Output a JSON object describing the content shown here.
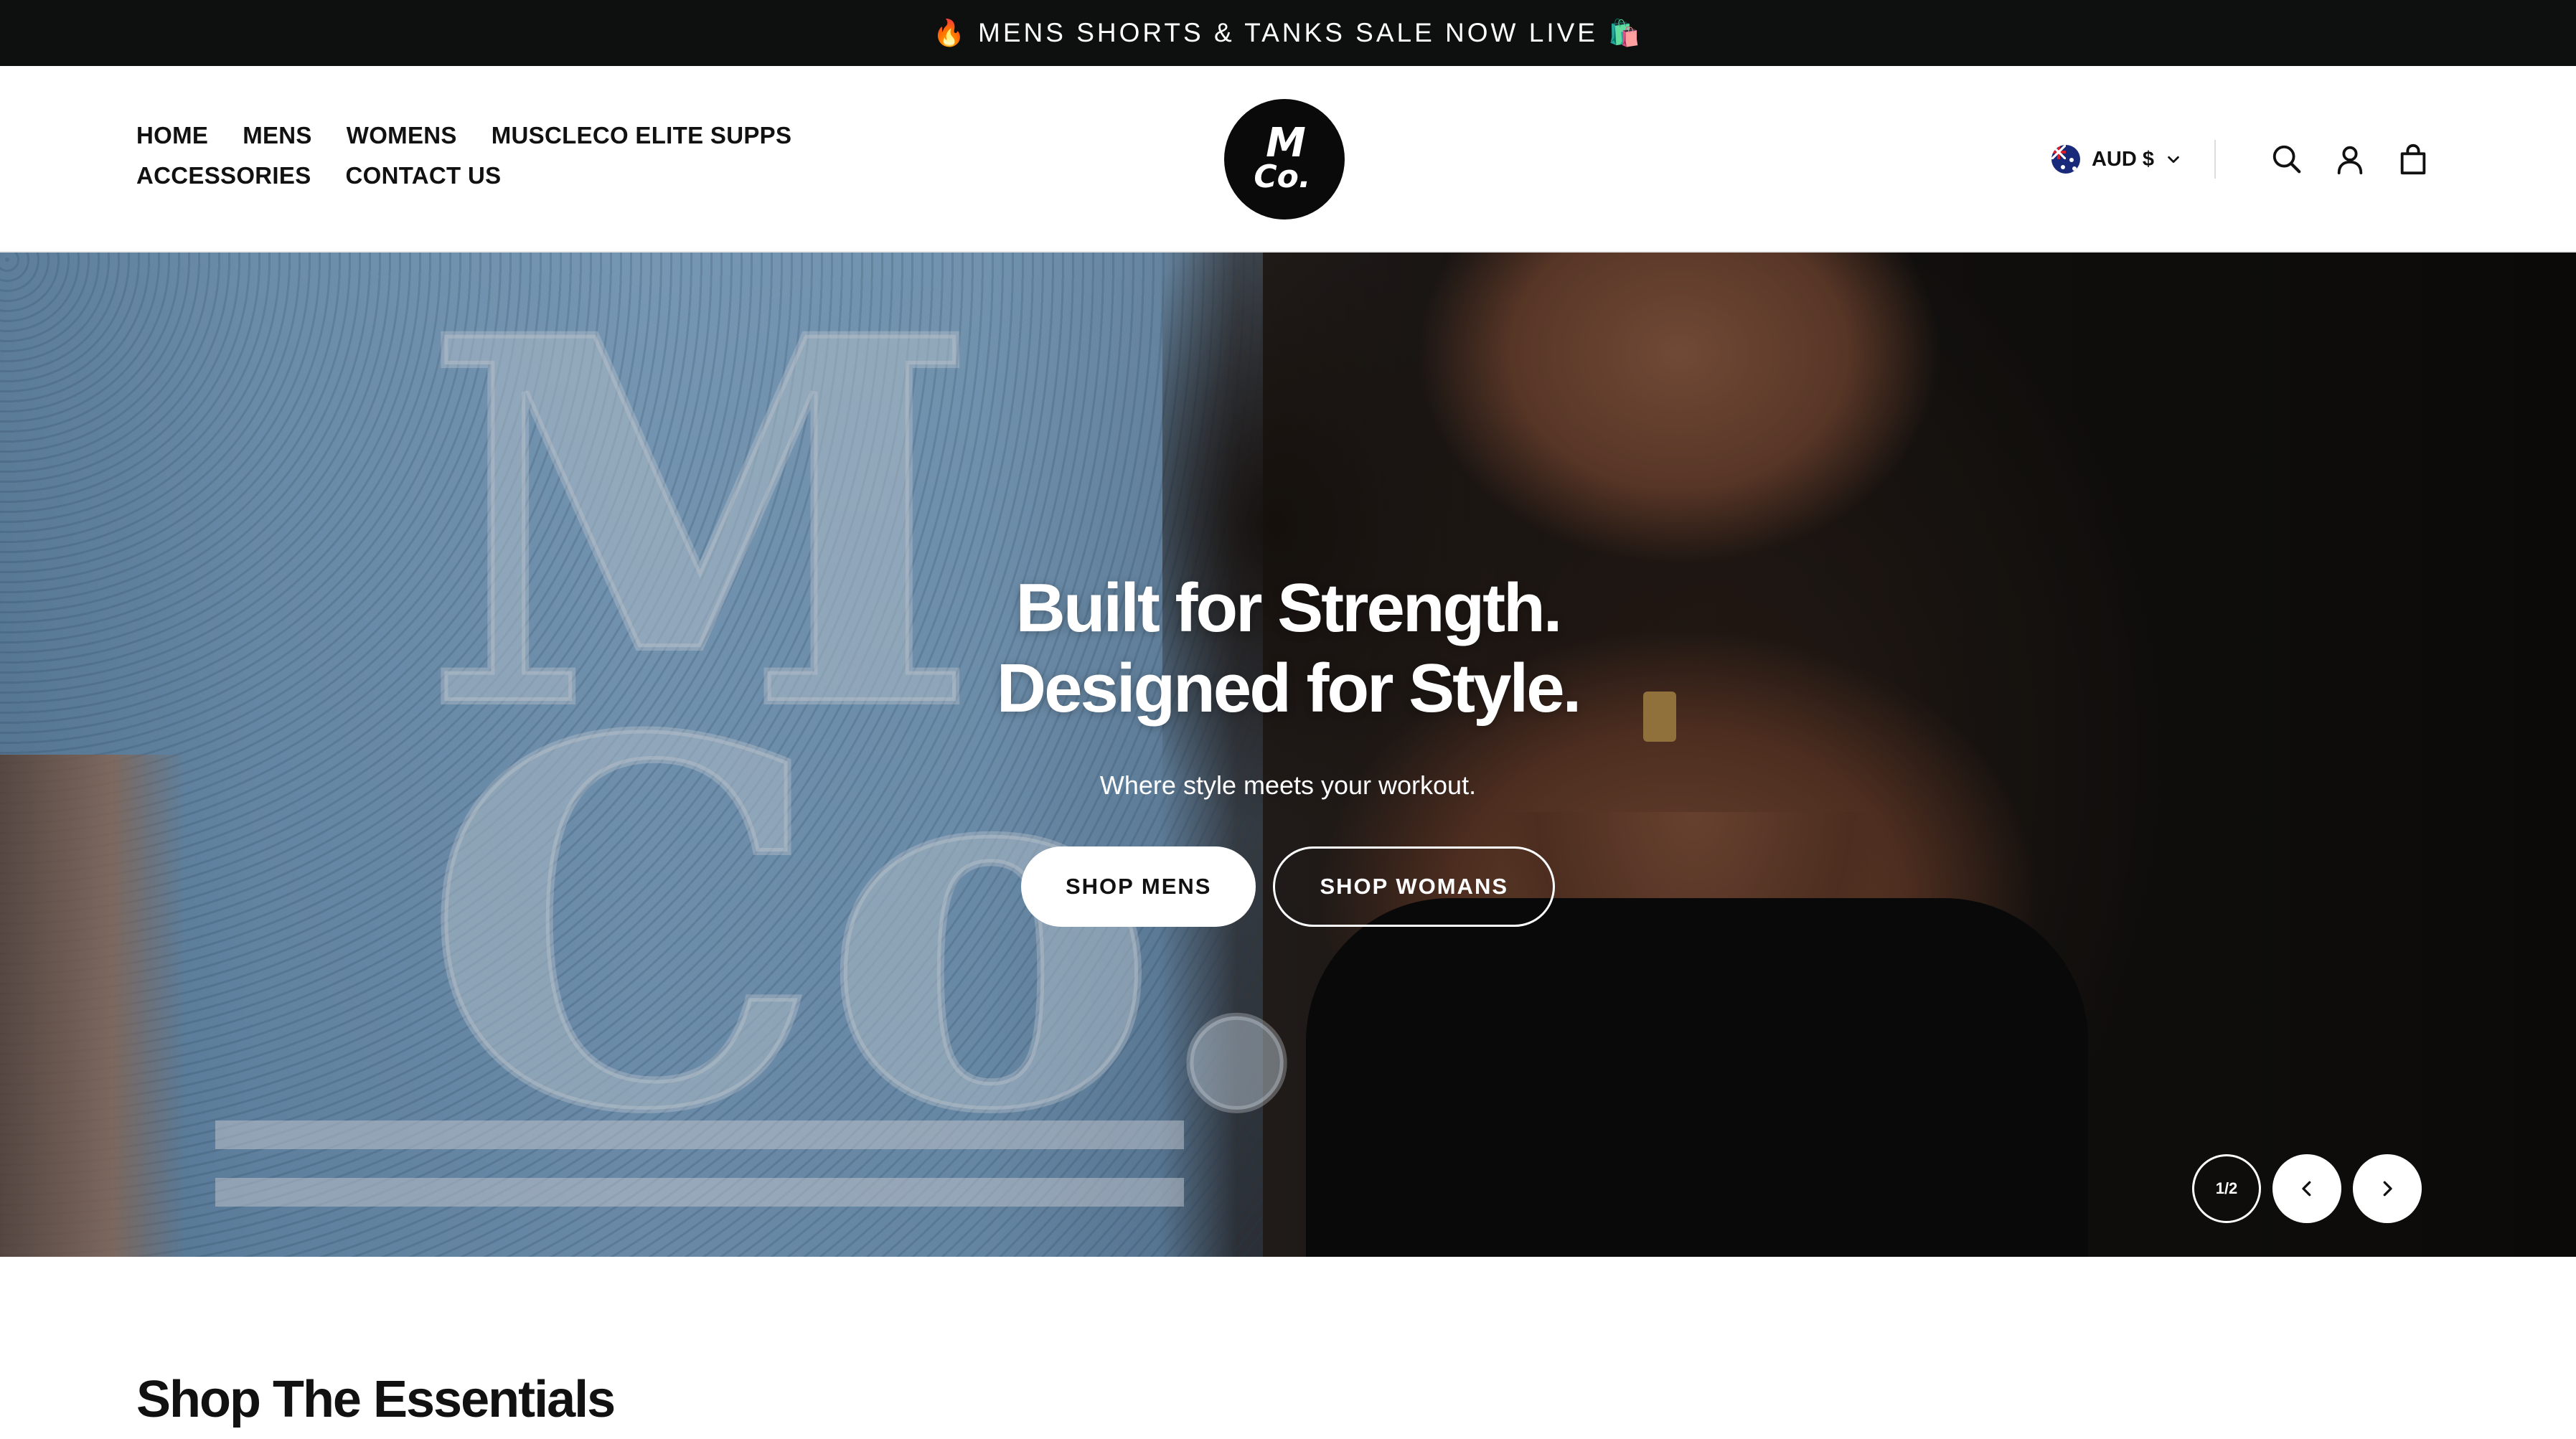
{
  "announcement": {
    "emoji_left": "🔥",
    "text": "MENS SHORTS & TANKS SALE NOW LIVE",
    "emoji_right": "🛍️"
  },
  "nav": {
    "items": [
      {
        "label": "HOME"
      },
      {
        "label": "MENS"
      },
      {
        "label": "WOMENS"
      },
      {
        "label": "MUSCLECO ELITE SUPPS"
      },
      {
        "label": "ACCESSORIES"
      },
      {
        "label": "CONTACT US"
      }
    ]
  },
  "logo": {
    "line1": "M",
    "line2": "Co."
  },
  "utilities": {
    "currency": "AUD $",
    "flag_icon": "australia-flag-icon",
    "icons": [
      "search-icon",
      "account-icon",
      "cart-icon"
    ]
  },
  "hero": {
    "title_line1": "Built for Strength.",
    "title_line2": "Designed for Style.",
    "subtitle": "Where style meets your workout.",
    "button_primary": "SHOP MENS",
    "button_secondary": "SHOP WOMANS",
    "slide_counter": "1/2"
  },
  "section": {
    "title": "Shop The Essentials"
  },
  "colors": {
    "announcement_bg": "#0e0f0f",
    "text_primary": "#111111",
    "button_bg": "#ffffff"
  }
}
